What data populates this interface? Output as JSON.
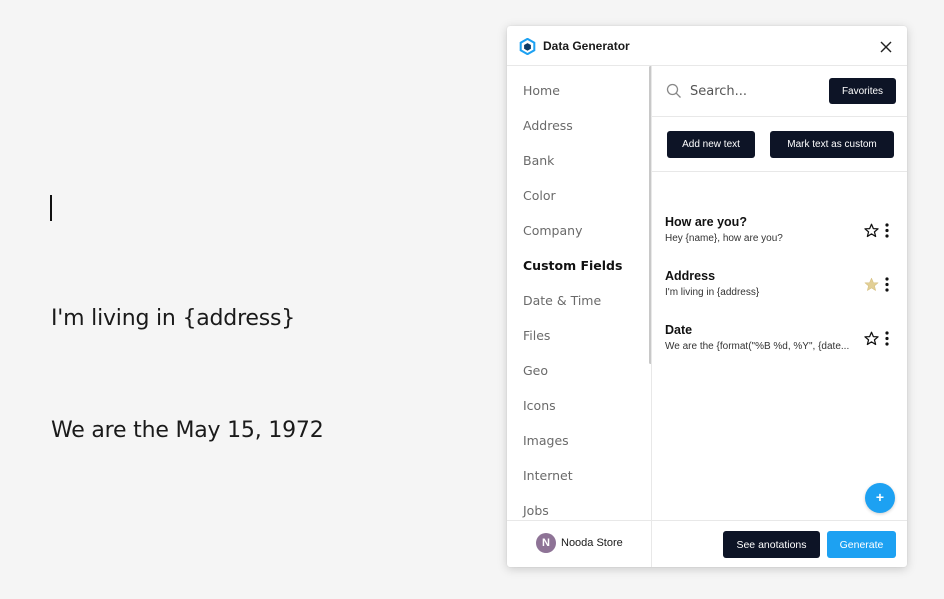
{
  "document": {
    "line1": "I'm living in {address}",
    "line2": "We are the May 15, 1972"
  },
  "panel": {
    "title": "Data Generator",
    "logo_icon": "data-generator-logo",
    "close_icon": "close-icon"
  },
  "sidebar": {
    "items": [
      {
        "label": "Home"
      },
      {
        "label": "Address"
      },
      {
        "label": "Bank"
      },
      {
        "label": "Color"
      },
      {
        "label": "Company"
      },
      {
        "label": "Custom Fields",
        "active": true
      },
      {
        "label": "Date & Time"
      },
      {
        "label": "Files"
      },
      {
        "label": "Geo"
      },
      {
        "label": "Icons"
      },
      {
        "label": "Images"
      },
      {
        "label": "Internet"
      },
      {
        "label": "Jobs"
      }
    ],
    "footer": {
      "avatar_letter": "N",
      "store_name": "Nooda Store"
    }
  },
  "search": {
    "placeholder": "Search...",
    "favorites_label": "Favorites"
  },
  "actions": {
    "add_new_text": "Add new text",
    "mark_custom": "Mark text as custom"
  },
  "items": [
    {
      "title": "How are you?",
      "subtitle": "Hey {name}, how are you?",
      "favorite": false
    },
    {
      "title": "Address",
      "subtitle": "I'm living in {address}",
      "favorite": true
    },
    {
      "title": "Date",
      "subtitle": "We are the {format(\"%B %d, %Y\", {date...",
      "favorite": false
    }
  ],
  "fab_label": "+",
  "footer": {
    "see_annotations": "See anotations",
    "generate": "Generate"
  },
  "colors": {
    "dark_button": "#0d1426",
    "accent_blue": "#1da1f2",
    "favorite_star": "#e2cf95",
    "avatar": "#8e7396"
  }
}
